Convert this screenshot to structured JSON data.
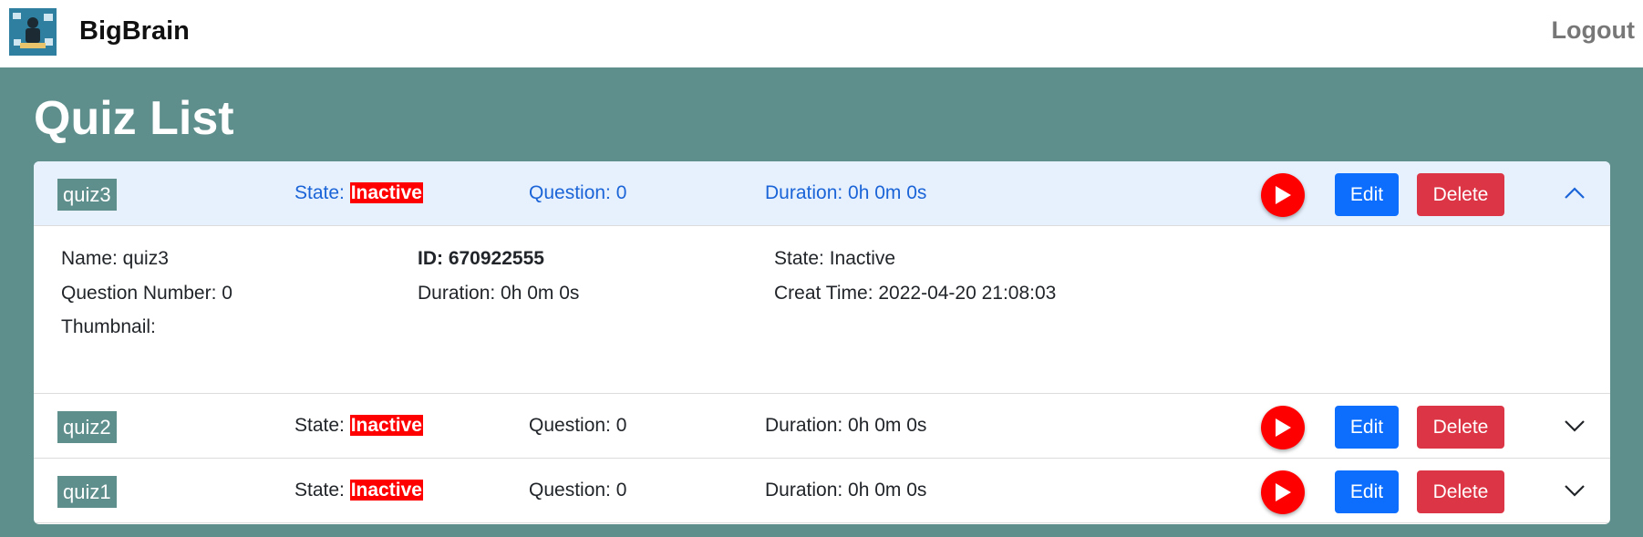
{
  "header": {
    "brand": "BigBrain",
    "logout_label": "Logout"
  },
  "page": {
    "title": "Quiz List"
  },
  "colors": {
    "background": "#5f8f8c",
    "open_row": "#e7f1fd",
    "state_badge": "#ff0000",
    "edit": "#0d6efd",
    "delete": "#dc3545"
  },
  "quizzes": [
    {
      "name": "quiz3",
      "state_label": "State:",
      "state_value": "Inactive",
      "question": "Question: 0",
      "duration": "Duration: 0h 0m 0s",
      "edit_label": "Edit",
      "delete_label": "Delete",
      "expanded": true,
      "details": {
        "name": "Name:  quiz3",
        "id": "ID:  670922555",
        "state": "State:  Inactive",
        "question_number": "Question Number:  0",
        "duration": "Duration:  0h 0m 0s",
        "creat_time": "Creat Time:  2022-04-20 21:08:03",
        "thumbnail": "Thumbnail:"
      }
    },
    {
      "name": "quiz2",
      "state_label": "State:",
      "state_value": "Inactive",
      "question": "Question: 0",
      "duration": "Duration: 0h 0m 0s",
      "edit_label": "Edit",
      "delete_label": "Delete",
      "expanded": false
    },
    {
      "name": "quiz1",
      "state_label": "State:",
      "state_value": "Inactive",
      "question": "Question: 0",
      "duration": "Duration: 0h 0m 0s",
      "edit_label": "Edit",
      "delete_label": "Delete",
      "expanded": false
    }
  ],
  "icons": {
    "logo": "bigbrain-logo",
    "play": "play-icon",
    "collapse": "chevron-up-icon",
    "expand": "chevron-down-icon"
  }
}
